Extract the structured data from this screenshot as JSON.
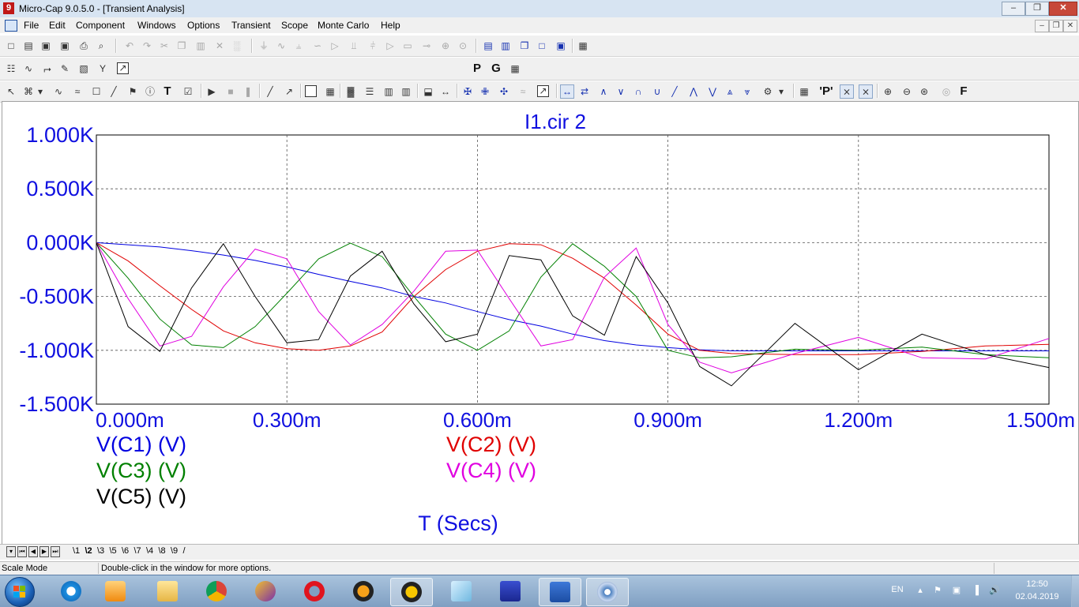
{
  "window": {
    "title": "Micro-Cap 9.0.5.0 - [Transient Analysis]",
    "app_icon": "9"
  },
  "menu": [
    "File",
    "Edit",
    "Component",
    "Windows",
    "Options",
    "Transient",
    "Scope",
    "Monte Carlo",
    "Help"
  ],
  "toolbar2_letters": {
    "p": "P",
    "g": "G"
  },
  "toolbar3_letters": {
    "t": "T",
    "p_quoted": "'P'",
    "f": "F"
  },
  "plot": {
    "title": "I1.cir 2",
    "xlabel": "T (Secs)",
    "x_ticks": [
      "0.000m",
      "0.300m",
      "0.600m",
      "0.900m",
      "1.200m",
      "1.500m"
    ],
    "y_ticks": [
      "1.000K",
      "0.500K",
      "0.000K",
      "-0.500K",
      "-1.000K",
      "-1.500K"
    ],
    "legend": [
      {
        "label": "V(C1) (V)",
        "color": "#0000e0"
      },
      {
        "label": "V(C2) (V)",
        "color": "#e00000"
      },
      {
        "label": "V(C3) (V)",
        "color": "#008000"
      },
      {
        "label": "V(C4) (V)",
        "color": "#e000e0"
      },
      {
        "label": "V(C5) (V)",
        "color": "#000000"
      }
    ],
    "title_color": "#1010e0",
    "axis_text_color": "#1010e0"
  },
  "chart_data": {
    "type": "line",
    "title": "I1.cir 2",
    "xlabel": "T (Secs)",
    "ylabel": "",
    "xlim": [
      0,
      0.0015
    ],
    "ylim": [
      -1500,
      1000
    ],
    "grid": true,
    "legend_position": "bottom-left",
    "series": [
      {
        "name": "V(C1) (V)",
        "color": "#0000e0",
        "x": [
          0,
          5e-05,
          0.0001,
          0.00015,
          0.0002,
          0.00025,
          0.0003,
          0.00035,
          0.0004,
          0.00045,
          0.0005,
          0.00055,
          0.0006,
          0.00065,
          0.0007,
          0.00075,
          0.0008,
          0.00085,
          0.0009,
          0.00095,
          0.001,
          0.0011,
          0.0012,
          0.0013,
          0.0014,
          0.0015
        ],
        "y": [
          0,
          -20,
          -40,
          -75,
          -115,
          -165,
          -225,
          -295,
          -360,
          -420,
          -500,
          -560,
          -640,
          -715,
          -775,
          -850,
          -910,
          -950,
          -975,
          -995,
          -1005,
          -1005,
          -1005,
          -1005,
          -1005,
          -1005
        ]
      },
      {
        "name": "V(C2) (V)",
        "color": "#e00000",
        "x": [
          0,
          5e-05,
          0.0001,
          0.00015,
          0.0002,
          0.00025,
          0.0003,
          0.00035,
          0.0004,
          0.00045,
          0.0005,
          0.00055,
          0.0006,
          0.00065,
          0.0007,
          0.00075,
          0.0008,
          0.00085,
          0.0009,
          0.00095,
          0.001,
          0.0011,
          0.0012,
          0.0013,
          0.0014,
          0.0015
        ],
        "y": [
          0,
          -170,
          -400,
          -620,
          -820,
          -930,
          -985,
          -1000,
          -960,
          -830,
          -500,
          -250,
          -80,
          -10,
          -20,
          -145,
          -330,
          -580,
          -850,
          -1000,
          -1030,
          -1040,
          -1040,
          -1010,
          -960,
          -945
        ]
      },
      {
        "name": "V(C3) (V)",
        "color": "#008000",
        "x": [
          0,
          5e-05,
          0.0001,
          0.00015,
          0.0002,
          0.00025,
          0.0003,
          0.00035,
          0.0004,
          0.00045,
          0.0005,
          0.00055,
          0.0006,
          0.00065,
          0.0007,
          0.00075,
          0.0008,
          0.00085,
          0.0009,
          0.00095,
          0.001,
          0.0011,
          0.0012,
          0.0013,
          0.0014,
          0.0015
        ],
        "y": [
          0,
          -330,
          -710,
          -950,
          -975,
          -780,
          -470,
          -150,
          -5,
          -130,
          -500,
          -850,
          -1000,
          -820,
          -320,
          -10,
          -220,
          -500,
          -1000,
          -1070,
          -1060,
          -990,
          -1000,
          -970,
          -1040,
          -1070
        ]
      },
      {
        "name": "V(C4) (V)",
        "color": "#e000e0",
        "x": [
          0,
          5e-05,
          0.0001,
          0.00015,
          0.0002,
          0.00025,
          0.0003,
          0.00035,
          0.0004,
          0.00045,
          0.0005,
          0.00055,
          0.0006,
          0.00065,
          0.0007,
          0.00075,
          0.0008,
          0.00085,
          0.0009,
          0.00095,
          0.001,
          0.0011,
          0.0012,
          0.0013,
          0.0014,
          0.0015
        ],
        "y": [
          0,
          -520,
          -960,
          -870,
          -410,
          -60,
          -150,
          -640,
          -950,
          -760,
          -450,
          -80,
          -70,
          -520,
          -960,
          -900,
          -320,
          -50,
          -760,
          -1110,
          -1210,
          -1030,
          -880,
          -1070,
          -1080,
          -890
        ]
      },
      {
        "name": "V(C5) (V)",
        "color": "#000000",
        "x": [
          0,
          5e-05,
          0.0001,
          0.00015,
          0.0002,
          0.00025,
          0.0003,
          0.00035,
          0.0004,
          0.00045,
          0.0005,
          0.00055,
          0.0006,
          0.00065,
          0.0007,
          0.00075,
          0.0008,
          0.00085,
          0.0009,
          0.00095,
          0.001,
          0.0011,
          0.0012,
          0.0013,
          0.0014,
          0.0015
        ],
        "y": [
          0,
          -780,
          -1010,
          -420,
          -10,
          -500,
          -930,
          -900,
          -310,
          -80,
          -570,
          -920,
          -850,
          -120,
          -160,
          -680,
          -860,
          -130,
          -560,
          -1150,
          -1330,
          -750,
          -1180,
          -850,
          -1040,
          -1160
        ]
      }
    ]
  },
  "tabs": {
    "items": [
      "1",
      "2",
      "3",
      "4",
      "5",
      "6",
      "7",
      "8",
      "9"
    ],
    "display_order": [
      "1",
      "2",
      "3",
      "5",
      "6",
      "7",
      "4",
      "8",
      "9"
    ],
    "active": "2"
  },
  "status": {
    "mode": "Scale Mode",
    "hint": "Double-click in the window for more options."
  },
  "taskbar": {
    "apps": [
      "internet-explorer",
      "media-player",
      "file-explorer",
      "chrome",
      "app-purple",
      "opera",
      "app-orange",
      "app-triangle",
      "app-cube",
      "save-disk",
      "word",
      "app-disc"
    ],
    "lang": "EN",
    "time": "12:50",
    "date": "02.04.2019"
  }
}
